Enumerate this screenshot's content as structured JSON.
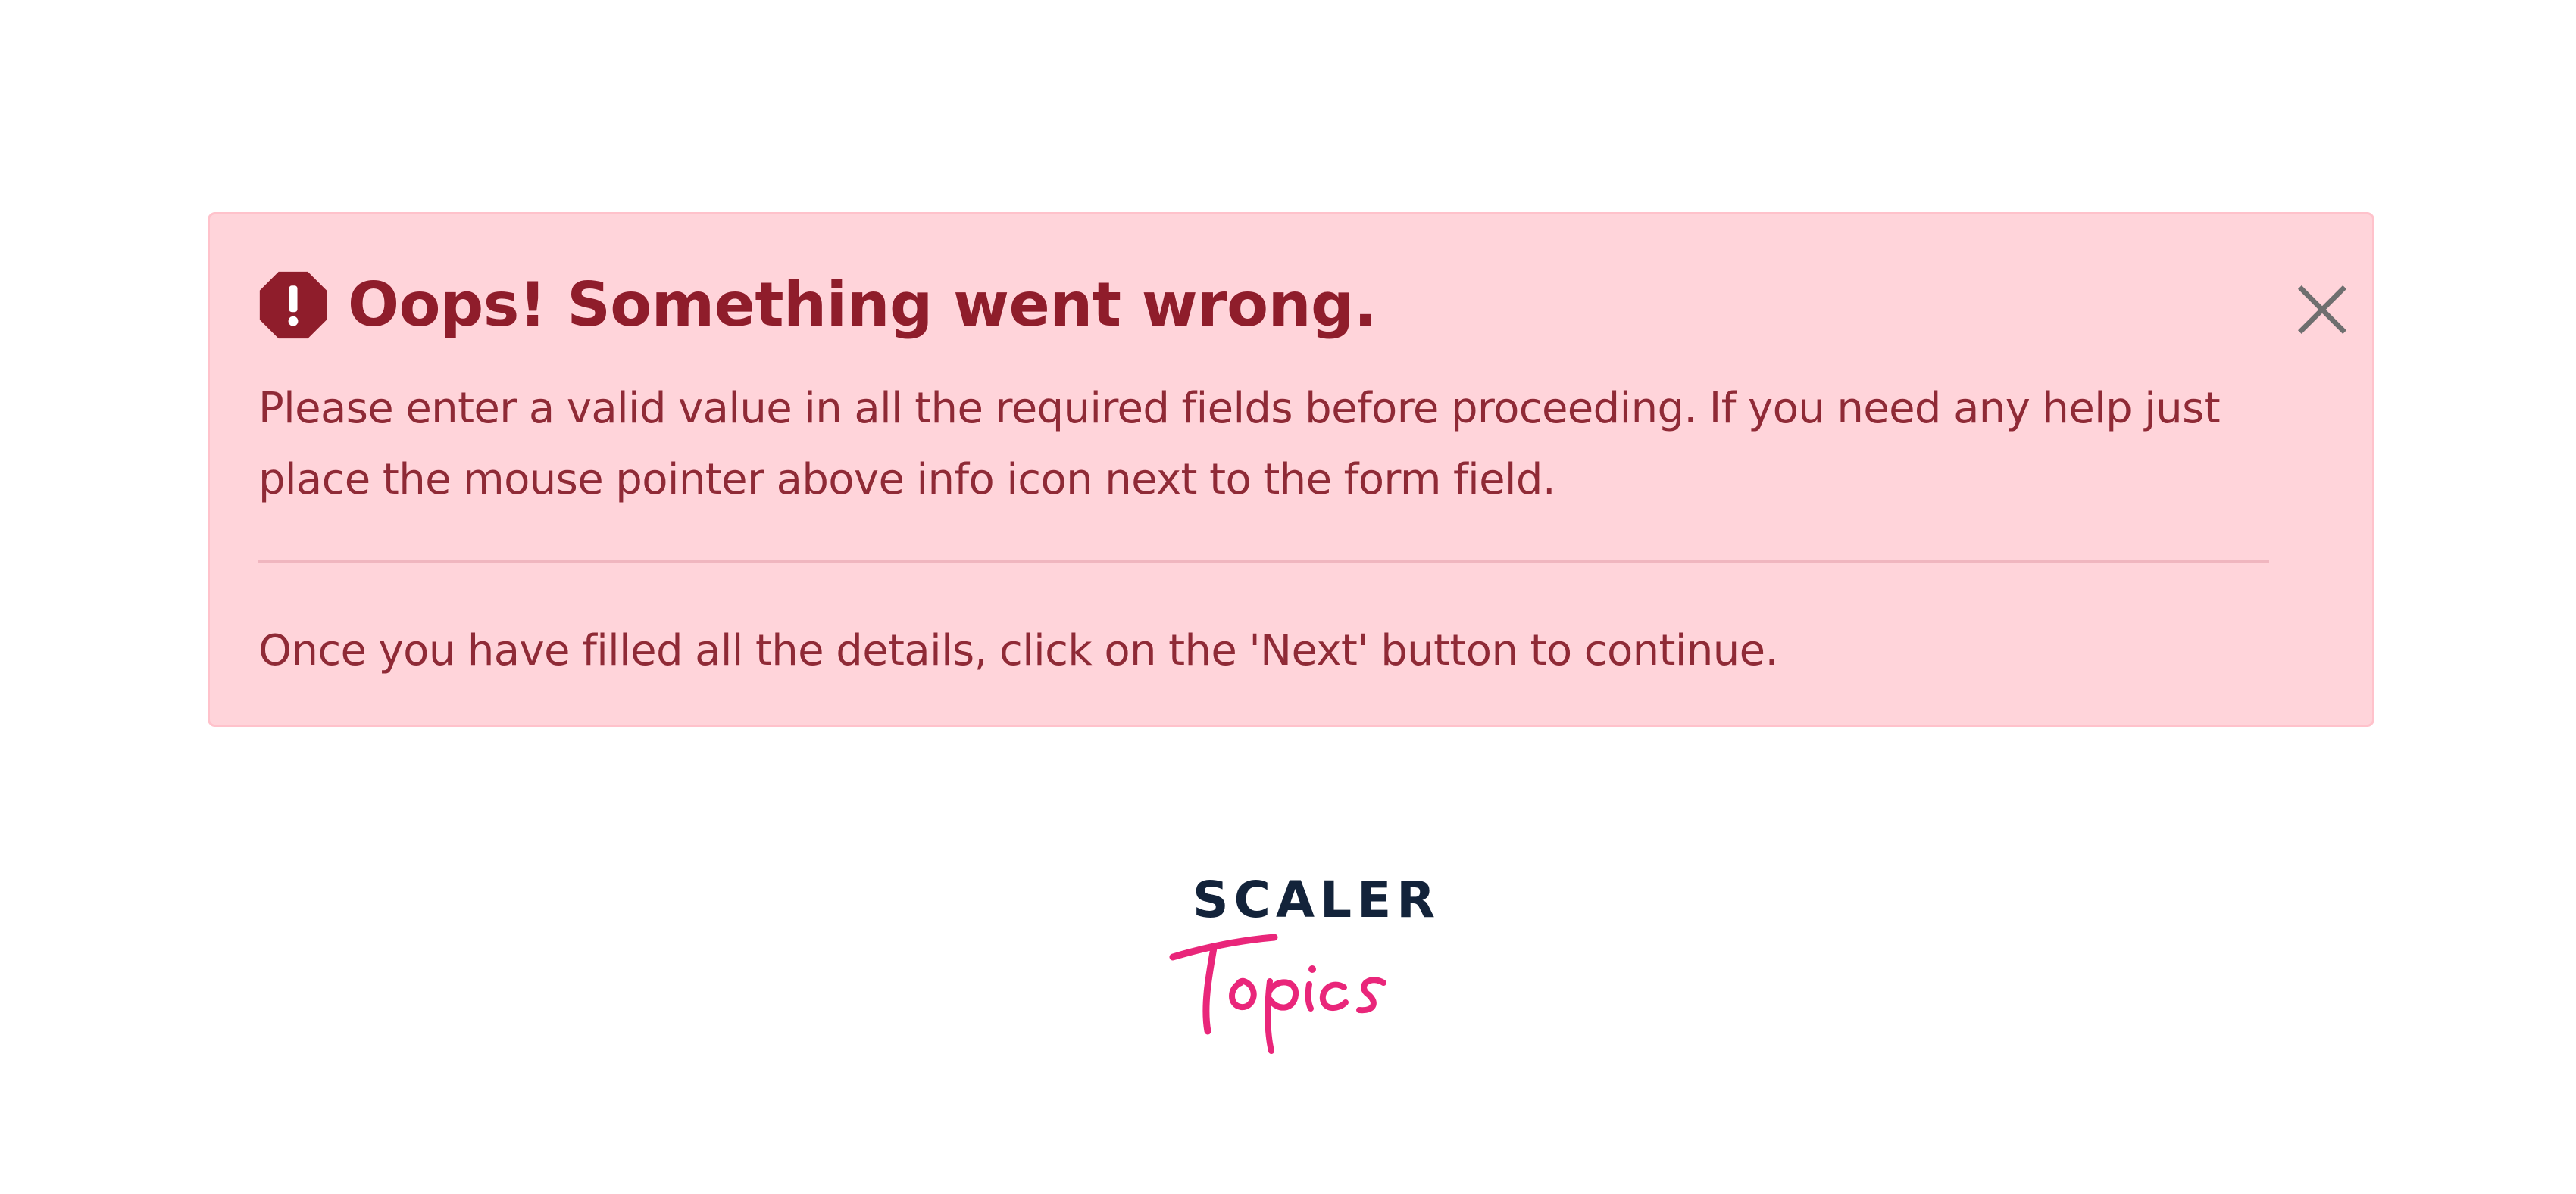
{
  "alert": {
    "title": "Oops! Something went wrong.",
    "message": "Please enter a valid value in all the required fields before proceeding. If you need any help just place the mouse pointer above info icon next to the form field.",
    "footer": "Once you have filled all the details, click on the 'Next' button to continue.",
    "icons": {
      "status": "error-octagon-icon",
      "close": "close-icon"
    },
    "colors": {
      "background": "#ffd4da",
      "border": "#ffc2cb",
      "text": "#8f1d2b",
      "icon": "#8f1d2b"
    }
  },
  "brand": {
    "name": "SCALER",
    "tagline": "Topics",
    "colors": {
      "name": "#13233a",
      "tagline": "#e9267a"
    }
  }
}
